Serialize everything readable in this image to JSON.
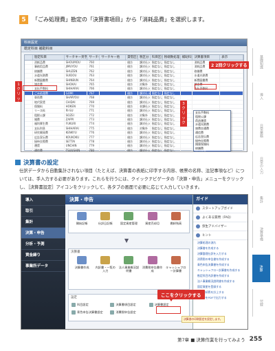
{
  "step": {
    "number": "5",
    "text": "「ごみ処理費」勘定の「決算書項目」から「消耗品費」を選択します。"
  },
  "shot1": {
    "window_title": "科目設定",
    "toolbar_text": "勘定科目  補助科目",
    "columns": [
      "",
      "勘定科目",
      "サーチキー英字",
      "サーチキー数字",
      "サーチキー他",
      "貸借区分",
      "税区分",
      "科目区分",
      "税端数処理",
      "補助科目",
      "決算書項目",
      "表示"
    ],
    "rows": [
      [
        "",
        "消耗品費",
        "SHOUMOU",
        "760",
        "",
        "借方",
        "課対仕入",
        "指定なし",
        "指定なし",
        "",
        "消耗品費",
        ""
      ],
      [
        "",
        "事務用品費",
        "JIMUYOU",
        "761",
        "",
        "借方",
        "課対仕入",
        "指定なし",
        "指定なし",
        "",
        "消耗品費",
        ""
      ],
      [
        "",
        "修繕費",
        "SHUZEN",
        "762",
        "",
        "借方",
        "課対仕入",
        "指定なし",
        "指定なし",
        "",
        "修繕費",
        ""
      ],
      [
        "",
        "水道光熱費",
        "SUIDOU",
        "763",
        "",
        "借方",
        "課対仕入",
        "指定なし",
        "指定なし",
        "",
        "水道光熱費",
        ""
      ],
      [
        "",
        "新聞図書費",
        "SHINBUN",
        "764",
        "",
        "借方",
        "課対仕入",
        "指定なし",
        "指定なし",
        "",
        "新聞図書費",
        ""
      ],
      [
        "",
        "諸会費",
        "SHOKAI",
        "765",
        "",
        "借方",
        "対象外",
        "指定なし",
        "指定なし",
        "",
        "諸会費",
        ""
      ],
      [
        "",
        "支払手数料",
        "SHIHARAI",
        "766",
        "",
        "借方",
        "課対仕入",
        "指定なし",
        "指定なし",
        "",
        "支払手数料",
        ""
      ],
      [
        "",
        "ごみ処理費",
        "GOMI",
        "767",
        "",
        "借方",
        "課対仕入",
        "指定なし",
        "指定なし",
        "",
        "",
        ""
      ],
      [
        "",
        "車両費",
        "SHARYOU",
        "768",
        "",
        "借方",
        "課対仕入",
        "指定なし",
        "指定なし",
        "",
        "",
        ""
      ],
      [
        "",
        "地代家賃",
        "CHIDAI",
        "769",
        "",
        "借方",
        "課対仕入",
        "指定なし",
        "指定なし",
        "",
        "",
        ""
      ],
      [
        "",
        "保険料",
        "HOKEN",
        "770",
        "",
        "借方",
        "非課仕入",
        "指定なし",
        "指定なし",
        "",
        "",
        ""
      ],
      [
        "",
        "リース料",
        "RI-SU",
        "771",
        "",
        "借方",
        "課対仕入",
        "指定なし",
        "指定なし",
        "",
        "",
        ""
      ],
      [
        "",
        "租税公課",
        "SOZEI",
        "772",
        "",
        "借方",
        "対象外",
        "指定なし",
        "指定なし",
        "",
        "",
        ""
      ],
      [
        "",
        "雑費",
        "ZAPPI",
        "773",
        "",
        "借方",
        "課対仕入",
        "指定なし",
        "指定なし",
        "",
        "",
        ""
      ],
      [
        "",
        "福利厚生費",
        "FUKURI",
        "774",
        "",
        "借方",
        "課対仕入",
        "指定なし",
        "指定なし",
        "",
        "",
        ""
      ],
      [
        "",
        "支払利息",
        "SHIHARAI",
        "775",
        "",
        "借方",
        "対象外",
        "指定なし",
        "指定なし",
        "",
        "",
        ""
      ],
      [
        "",
        "研究開発費",
        "KENKYU",
        "776",
        "",
        "借方",
        "課対仕入",
        "指定なし",
        "指定なし",
        "",
        "",
        ""
      ],
      [
        "",
        "広告宣伝費",
        "KOUKOKU",
        "777",
        "",
        "借方",
        "課対仕入",
        "指定なし",
        "指定なし",
        "",
        "減価償却費",
        ""
      ],
      [
        "",
        "接待交際費",
        "SETTAI",
        "778",
        "",
        "借方",
        "課対仕入",
        "指定なし",
        "指定なし",
        "",
        "福利厚生費",
        ""
      ],
      [
        "",
        "運賃",
        "UNCHIN",
        "779",
        "",
        "借方",
        "課対仕入",
        "指定なし",
        "指定なし",
        "",
        "接待交際費",
        ""
      ],
      [
        "",
        "通信費",
        "TSUUSHIN",
        "780",
        "",
        "借方",
        "課対仕入",
        "指定なし",
        "指定なし",
        "",
        "損害保険料",
        ""
      ]
    ],
    "dropdown_options": [
      "支払手数料",
      "租税公課",
      "荷造運賃",
      "水道光熱費",
      "旅費交通費",
      "通信費",
      "広告宣伝費",
      "接待交際費",
      "損害保険料",
      "修繕費",
      "消耗品費",
      "減価償却費",
      "福利厚生費",
      "給料賃金",
      "外注工賃"
    ],
    "callout_top": "2 2回クリックする",
    "callout_left": "1 クリック",
    "callout_mid": "3 クリック"
  },
  "section": {
    "title": "決算書の設定",
    "body": "仕訳データから自動集計されない項目（たとえば、決算書の表紙に印字する内容、帳票の名称、注記事項など）については、手入力する必要があります。これらを行うには、クイックナビゲータの「決算・申告」メニューをクリックし、［決算書設定］アイコンをクリックして、各タブの画面で必要に応じて入力していきます。"
  },
  "shot2": {
    "nav_items": [
      "導入",
      "取引",
      "集計",
      "決算・申告",
      "分析・予測",
      "資金繰り",
      "事業所データ"
    ],
    "active_nav": 3,
    "center_title": "決算・申告",
    "top_icons": [
      "開始記帳",
      "仕訳日記帳",
      "固定資産管理",
      "資産売却月",
      "棚卸残高"
    ],
    "middle_label": "決算書",
    "mid_icons": [
      "決算書作成",
      "内訳書・一覧の入力",
      "法人事業概況説明書",
      "消費税申告書作成",
      "キャッシュフロー計算書"
    ],
    "settings_label": "設定",
    "settings": [
      "科目設定",
      "決算書項目設定",
      "決算書設定",
      "青色申告決算書設定",
      "消費税申告設定"
    ],
    "callout": "ここをクリックする",
    "hint": "決算書の印刷設定を設定します。",
    "guide_title": "ガイド",
    "guide_items": [
      "スタートアップガイド",
      "よくある質問（FAQ）",
      "弥生アドバイザー",
      "ヒント"
    ],
    "guide_links": [
      "決算処理の流れ",
      "決算書を作成する",
      "決算整理仕訳を入力する",
      "消費税の申告書を作成する",
      "青色申告決算書を作成する",
      "キャッシュフロー計算書を作成する",
      "勘定科目内訳書を作成する",
      "法人事業概況説明書を作成する",
      "固定資産を登録する",
      "減価償却費を計上する",
      "決算書をPDFで出力する"
    ]
  },
  "tabs": [
    "基礎知識",
    "導入",
    "日常業務",
    "日常の入力",
    "集計",
    "決算準備",
    "決算",
    "付録"
  ],
  "active_tab": 6,
  "footer": {
    "chapter": "第7章 ■ 決算作業を行ってみよう",
    "page": "255"
  }
}
